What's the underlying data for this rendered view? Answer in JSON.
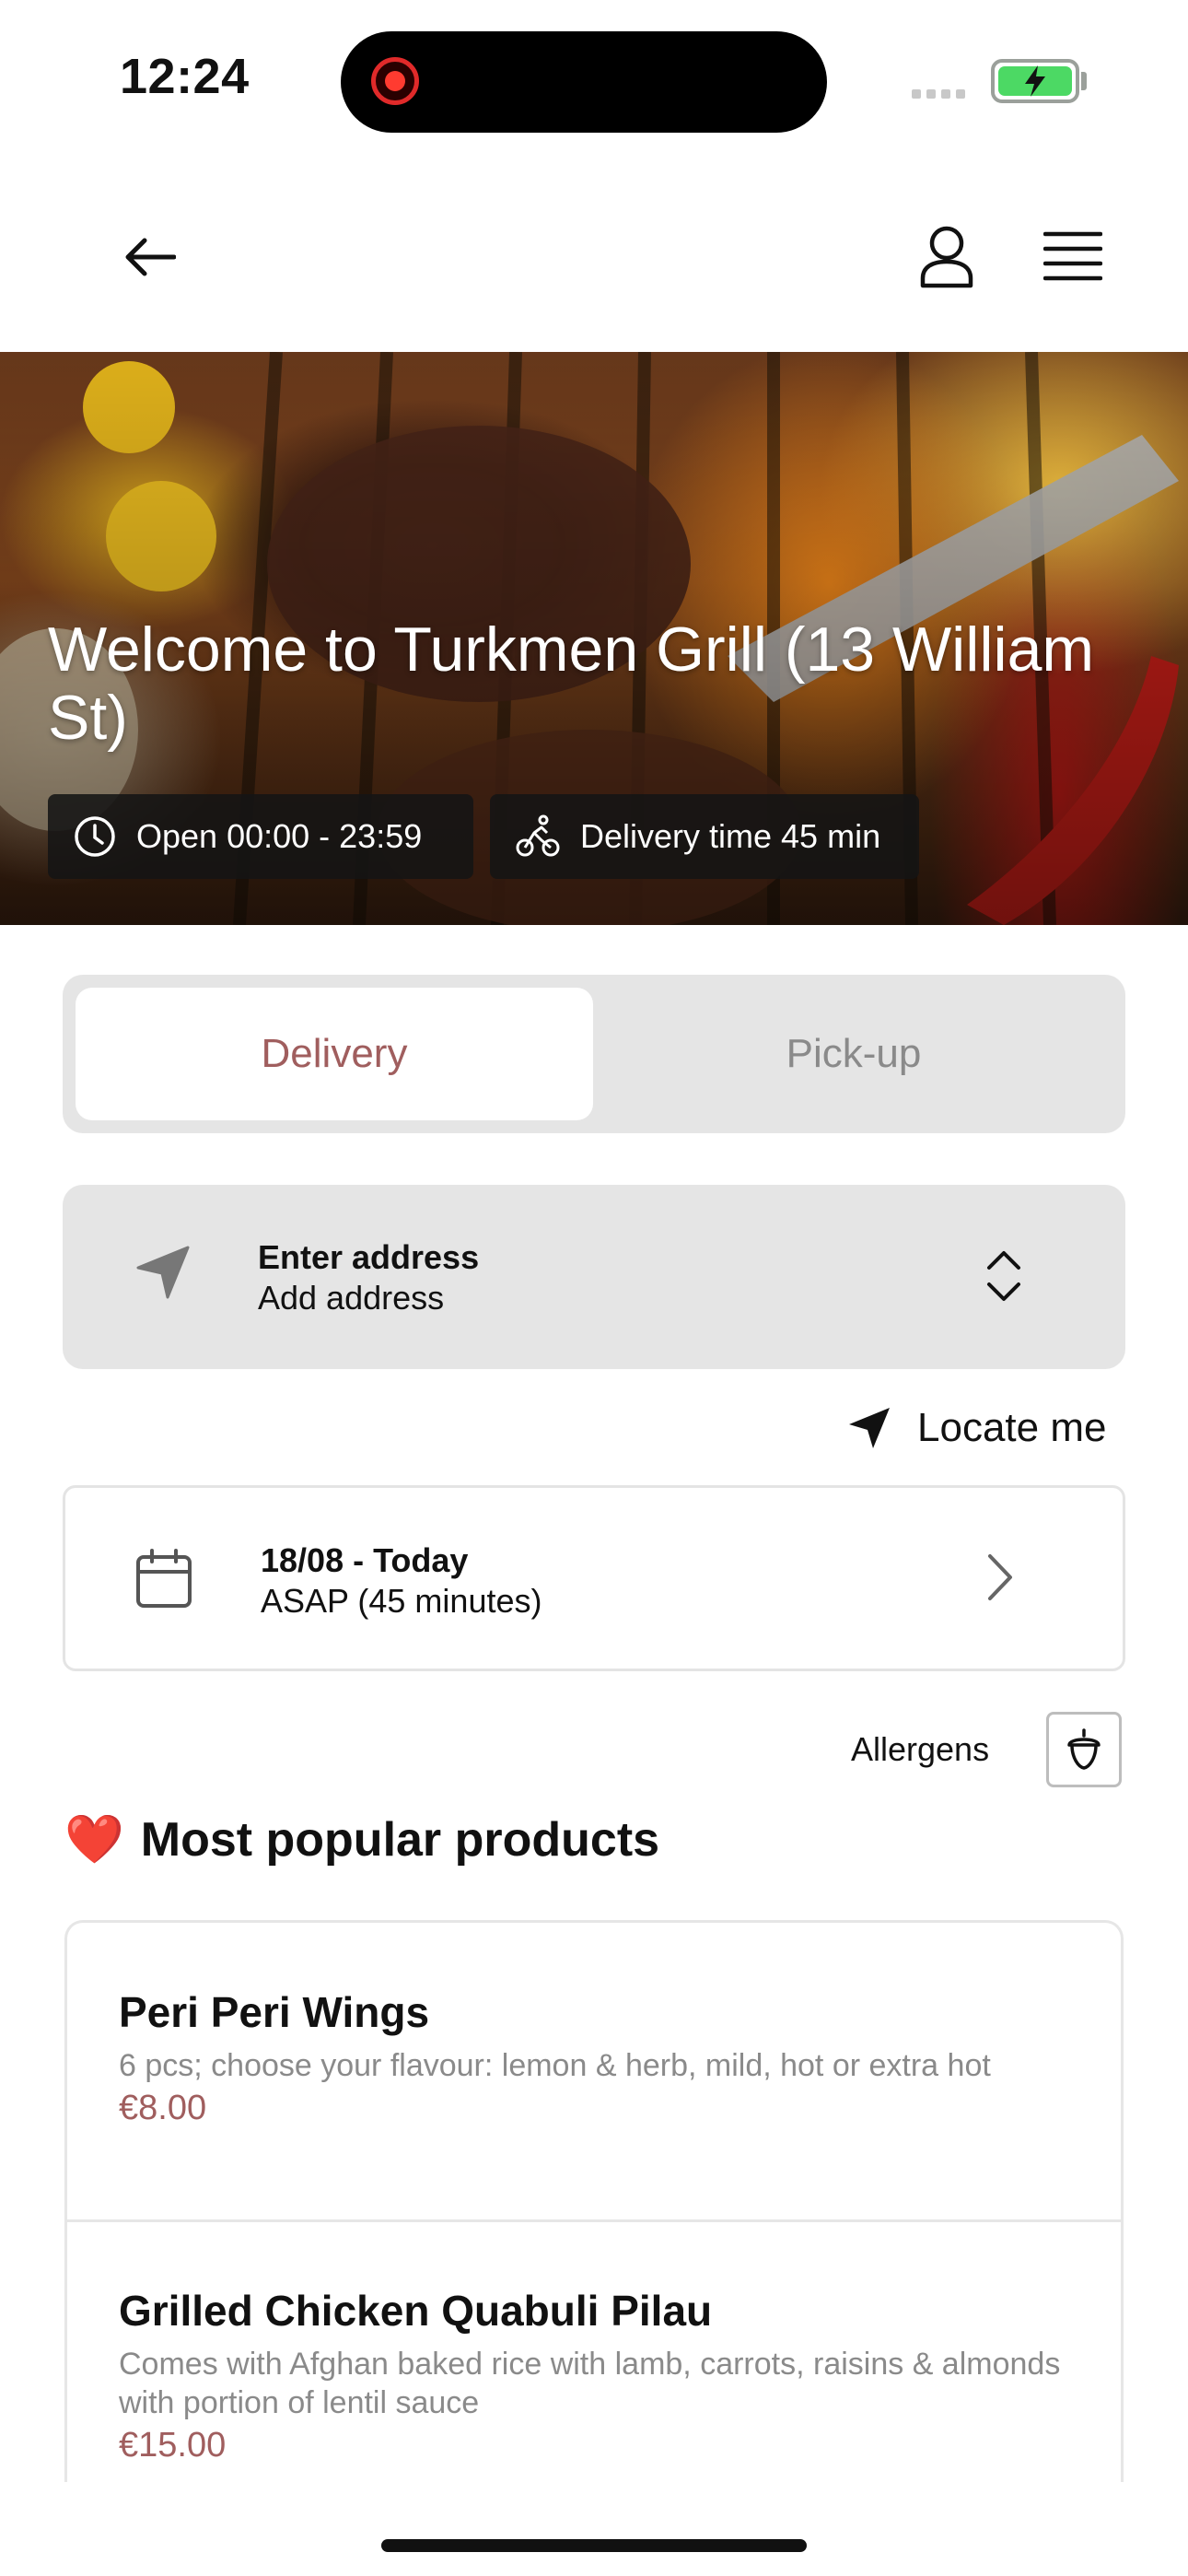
{
  "status_bar": {
    "time": "12:24"
  },
  "hero": {
    "title": "Welcome to Turkmen Grill (13 William St)",
    "open_hours": "Open 00:00 - 23:59",
    "delivery_time": "Delivery time 45 min"
  },
  "order_mode": {
    "options": [
      "Delivery",
      "Pick-up"
    ],
    "selected": "Delivery"
  },
  "address": {
    "title": "Enter address",
    "subtitle": "Add address"
  },
  "locate_label": "Locate me",
  "schedule": {
    "date": "18/08 - Today",
    "time": "ASAP (45 minutes)"
  },
  "allergens_label": "Allergens",
  "popular": {
    "emoji": "❤️",
    "title": "Most popular products",
    "products": [
      {
        "name": "Peri Peri Wings",
        "description": "6 pcs; choose your flavour: lemon & herb, mild, hot or extra hot",
        "price": "€8.00"
      },
      {
        "name": "Grilled Chicken Quabuli Pilau",
        "description": "Comes with Afghan baked rice with lamb, carrots, raisins & almonds with portion of lentil sauce",
        "price": "€15.00"
      }
    ]
  },
  "colors": {
    "accent": "#a05e5e",
    "panel": "#e5e5e5"
  }
}
